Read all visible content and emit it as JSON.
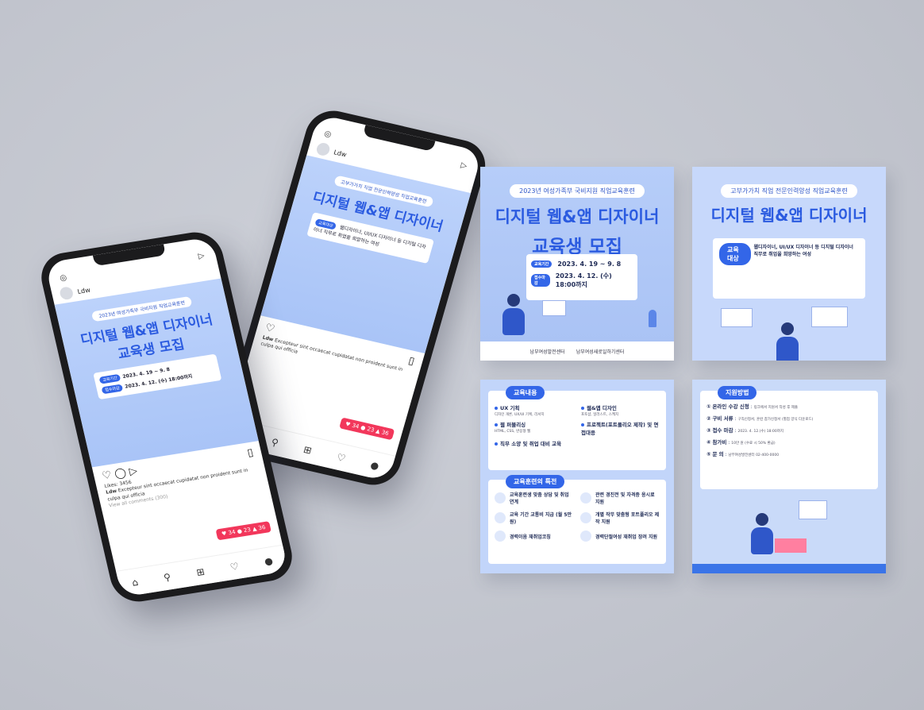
{
  "course": {
    "subtitle": "2023년 여성가족부 국비지원 직업교육훈련",
    "title_line1": "디지털 웹&앱 디자이너",
    "title_line2": "교육생 모집",
    "period_label": "교육기간",
    "period_value": "2023. 4. 19 ~ 9. 8",
    "deadline_label": "접수마감",
    "deadline_value": "2023. 4. 12. (수) 18:00까지"
  },
  "org": {
    "name1": "남부여성발전센터",
    "name2": "남부여성새로일하기센터"
  },
  "card2": {
    "subtitle": "고부가가치 직업 전문인력양성 직업교육훈련",
    "title": "디지털 웹&앱 디자이너",
    "target_label": "교육대상",
    "target_title": "웹디자이너, UI/UX 디자이너 등 디지털 디자이너 직무로 취업을 희망하는 여성"
  },
  "card3": {
    "edu_label": "교육내용",
    "edu_items": [
      {
        "title": "UX 기획",
        "desc": "디자인 개론, UX/UI 기획, 리서치"
      },
      {
        "title": "웹&앱 디자인",
        "desc": "포토샵, 일러스트, 스케치"
      },
      {
        "title": "웹 퍼블리싱",
        "desc": "HTML, CSS, 반응형 웹"
      },
      {
        "title": "프로젝트(포트폴리오 제작) 및 면접대응",
        "desc": ""
      },
      {
        "title": "직무 소양 및 취업 대비 교육",
        "desc": ""
      }
    ],
    "feature_label": "교육훈련의 특전",
    "features": [
      "교육훈련생 맞춤 상담 및 취업 연계",
      "관련 경진전 및 자격증 응시료 지원",
      "교육 기간 교통비 지급 (월 5만 원)",
      "개별 작무 맞춤형 포트폴리오 제작 지원",
      "경력이음 재취업코칭",
      "경력단절여성 재취업 장려 지원"
    ]
  },
  "card4": {
    "apply_label": "지원방법",
    "rows": [
      {
        "num": "①",
        "title": "온라인 수강 신청",
        "desc": "링크에서 지원서 작성 후 제출"
      },
      {
        "num": "②",
        "title": "구비 서류",
        "desc": "구직신청서, 훈련 참가신청서 (별첨 양식 다운로드)"
      },
      {
        "num": "③",
        "title": "접수 마감",
        "desc": "2023. 4. 12.(수) 18:00까지"
      },
      {
        "num": "④",
        "title": "참가비",
        "desc": "10만 원 (수료 시 50% 환급)"
      },
      {
        "num": "⑤",
        "title": "문 의",
        "desc": "남부여성발전센터 02-400-0000"
      }
    ]
  },
  "instagram": {
    "username": "Ldw",
    "likes": "Likes: 3456",
    "caption_user": "Ldw",
    "caption": "Excepteur sint occaecat cupidatat non proident sunt in culpa qui officia",
    "view_comments": "View all comments (300)",
    "notif_likes": "34",
    "notif_comments": "23",
    "notif_follows": "36"
  }
}
